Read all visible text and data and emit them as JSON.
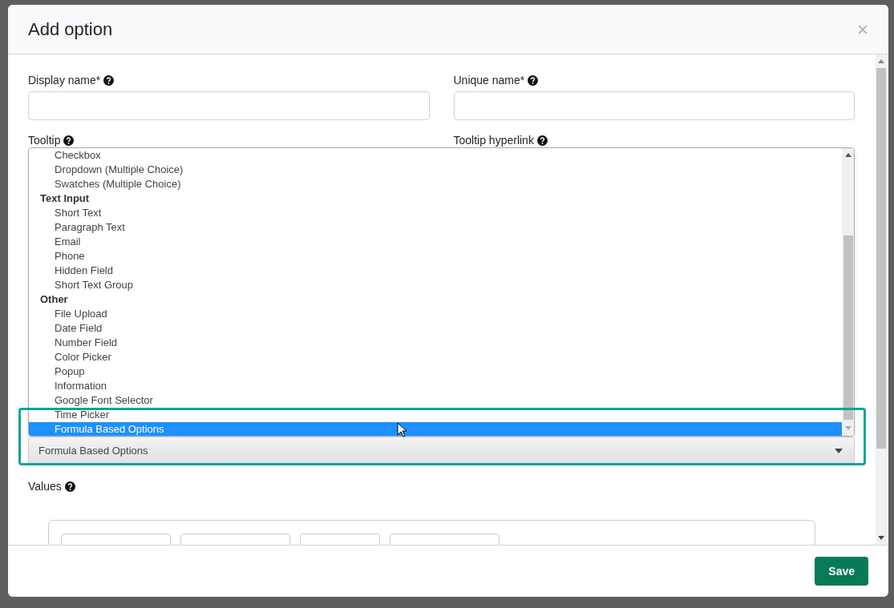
{
  "modal": {
    "title": "Add option",
    "close": "×"
  },
  "fields": [
    {
      "label": "Display name*"
    },
    {
      "label": "Unique name*"
    }
  ],
  "tooltip_labels": [
    {
      "label": "Tooltip"
    },
    {
      "label": "Tooltip hyperlink"
    }
  ],
  "dropdown": {
    "options": [
      {
        "kind": "option",
        "label": "Checkbox",
        "selected": false
      },
      {
        "kind": "option",
        "label": "Dropdown (Multiple Choice)",
        "selected": false
      },
      {
        "kind": "option",
        "label": "Swatches (Multiple Choice)",
        "selected": false
      },
      {
        "kind": "group",
        "label": "Text Input"
      },
      {
        "kind": "option",
        "label": "Short Text",
        "selected": false
      },
      {
        "kind": "option",
        "label": "Paragraph Text",
        "selected": false
      },
      {
        "kind": "option",
        "label": "Email",
        "selected": false
      },
      {
        "kind": "option",
        "label": "Phone",
        "selected": false
      },
      {
        "kind": "option",
        "label": "Hidden Field",
        "selected": false
      },
      {
        "kind": "option",
        "label": "Short Text Group",
        "selected": false
      },
      {
        "kind": "group",
        "label": "Other"
      },
      {
        "kind": "option",
        "label": "File Upload",
        "selected": false
      },
      {
        "kind": "option",
        "label": "Date Field",
        "selected": false
      },
      {
        "kind": "option",
        "label": "Number Field",
        "selected": false
      },
      {
        "kind": "option",
        "label": "Color Picker",
        "selected": false
      },
      {
        "kind": "option",
        "label": "Popup",
        "selected": false
      },
      {
        "kind": "option",
        "label": "Information",
        "selected": false
      },
      {
        "kind": "option",
        "label": "Google Font Selector",
        "selected": false
      },
      {
        "kind": "option",
        "label": "Time Picker",
        "selected": false
      },
      {
        "kind": "option",
        "label": "Formula Based Options",
        "selected": true
      }
    ],
    "value": "Formula Based Options"
  },
  "values_label": "Values",
  "save_button": "Save"
}
